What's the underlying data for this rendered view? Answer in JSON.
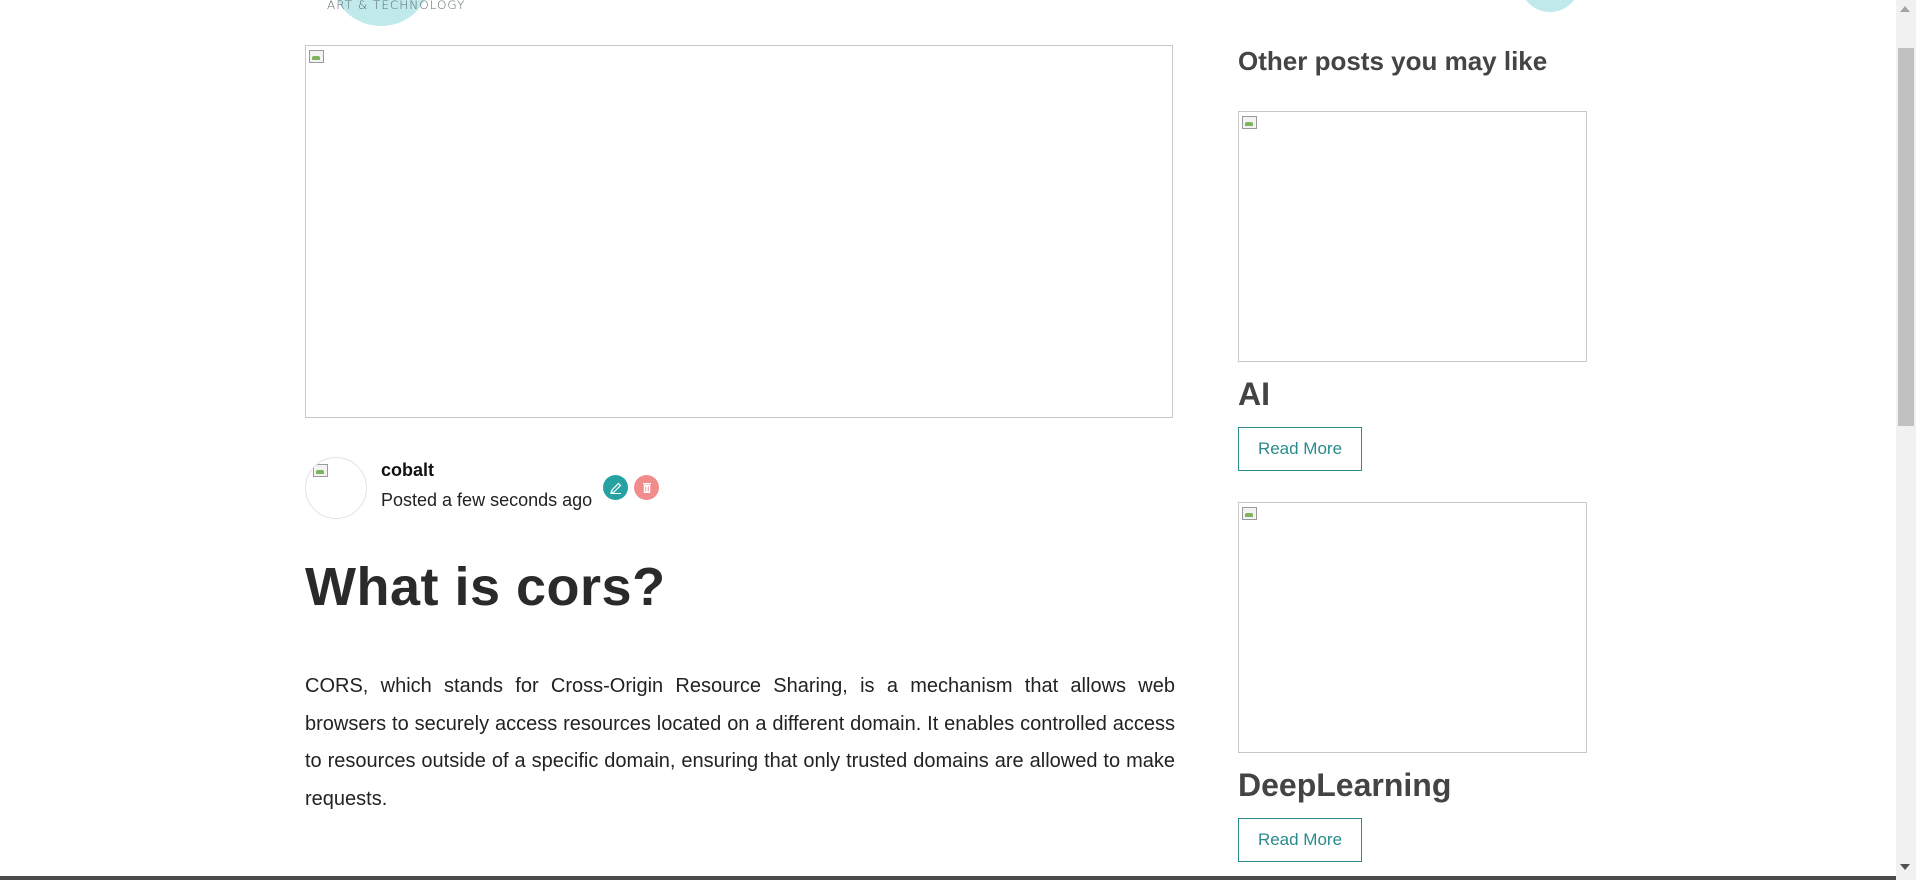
{
  "header": {
    "logo_text": "ART & TECHNOLOGY"
  },
  "post": {
    "author": "cobalt",
    "posted": "Posted a few seconds ago",
    "title": "What is cors?",
    "body": "CORS, which stands for Cross-Origin Resource Sharing, is a mechanism that allows web browsers to securely access resources located on a different domain. It enables controlled access to resources outside of a specific domain, ensuring that only trusted domains are allowed to make requests.",
    "edit_icon": "pencil-icon",
    "delete_icon": "trash-icon"
  },
  "sidebar": {
    "title": "Other posts you may like",
    "posts": [
      {
        "title": "AI",
        "button": "Read More"
      },
      {
        "title": "DeepLearning",
        "button": "Read More"
      }
    ]
  },
  "colors": {
    "accent": "#2a8a8c",
    "edit": "#27a2a3",
    "delete": "#f08c8c",
    "logo_circle": "#bfe9ea"
  }
}
